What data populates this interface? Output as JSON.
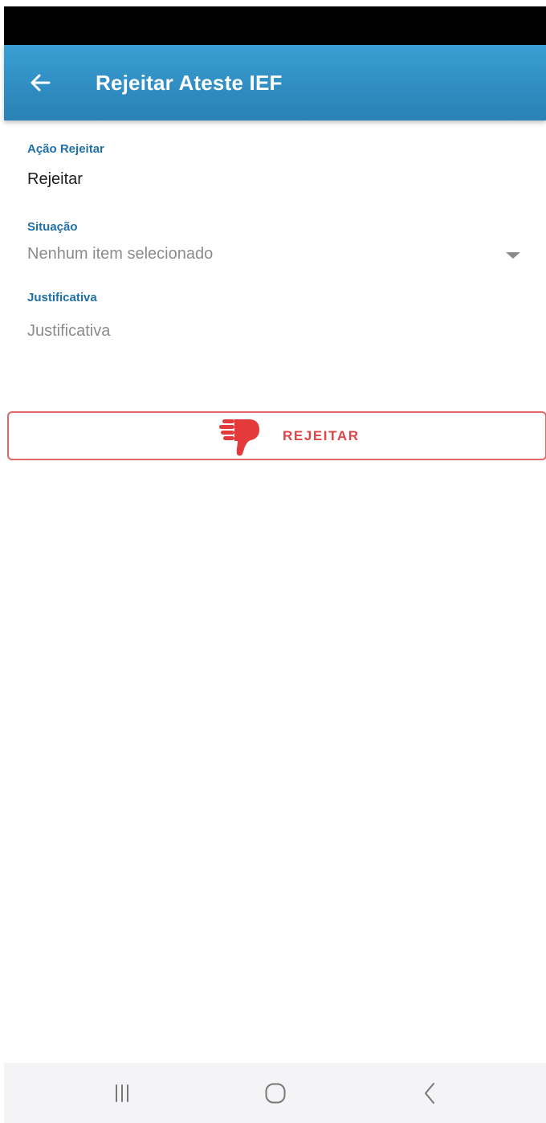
{
  "app_bar": {
    "title": "Rejeitar Ateste IEF",
    "back_icon": "arrow-left-icon",
    "background": "#3597cd"
  },
  "form": {
    "acao": {
      "label": "Ação Rejeitar",
      "value": "Rejeitar"
    },
    "situacao": {
      "label": "Situação",
      "placeholder": "Nenhum item selecionado",
      "icon": "caret-down-icon"
    },
    "justificativa": {
      "label": "Justificativa",
      "placeholder": "Justificativa"
    }
  },
  "reject_button": {
    "label": "REJEITAR",
    "icon": "thumbs-down-icon",
    "color": "#e04545"
  },
  "nav_bar": {
    "recents_icon": "recents-icon",
    "home_icon": "home-icon",
    "back_icon": "back-chevron-icon"
  }
}
